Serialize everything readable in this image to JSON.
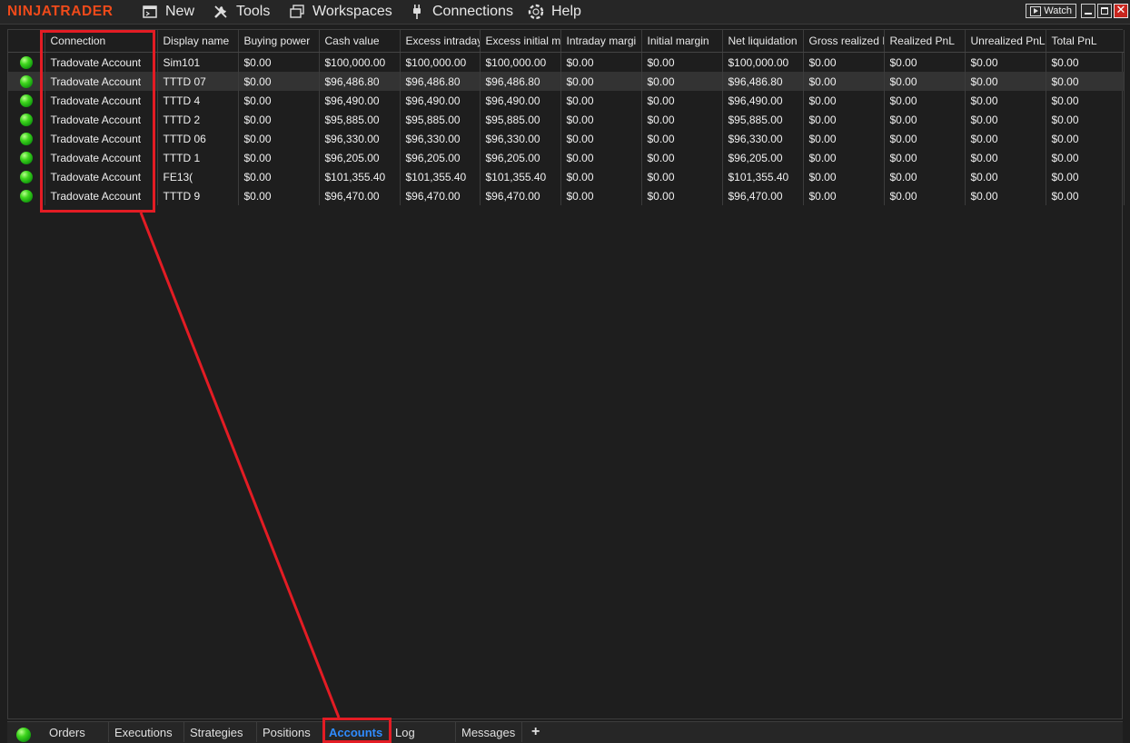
{
  "app": {
    "logo": "NINJATRADER",
    "menu": [
      "New",
      "Tools",
      "Workspaces",
      "Connections",
      "Help"
    ],
    "watch_label": "Watch",
    "close_glyph": "✕"
  },
  "accounts_grid": {
    "columns": [
      "",
      "Connection",
      "Display name",
      "Buying power",
      "Cash value",
      "Excess intraday",
      "Excess initial m",
      "Intraday margi",
      "Initial margin",
      "Net liquidation",
      "Gross realized I",
      "Realized PnL",
      "Unrealized PnL",
      "Total PnL"
    ],
    "rows": [
      {
        "status": "connected",
        "cells": [
          "Tradovate Account",
          "Sim101",
          "$0.00",
          "$100,000.00",
          "$100,000.00",
          "$100,000.00",
          "$0.00",
          "$0.00",
          "$100,000.00",
          "$0.00",
          "$0.00",
          "$0.00",
          "$0.00"
        ]
      },
      {
        "status": "connected",
        "cells": [
          "Tradovate Account",
          "TTTD      07",
          "$0.00",
          "$96,486.80",
          "$96,486.80",
          "$96,486.80",
          "$0.00",
          "$0.00",
          "$96,486.80",
          "$0.00",
          "$0.00",
          "$0.00",
          "$0.00"
        ]
      },
      {
        "status": "connected",
        "cells": [
          "Tradovate Account",
          "TTTD       4",
          "$0.00",
          "$96,490.00",
          "$96,490.00",
          "$96,490.00",
          "$0.00",
          "$0.00",
          "$96,490.00",
          "$0.00",
          "$0.00",
          "$0.00",
          "$0.00"
        ]
      },
      {
        "status": "connected",
        "cells": [
          "Tradovate Account",
          "TTTD       2",
          "$0.00",
          "$95,885.00",
          "$95,885.00",
          "$95,885.00",
          "$0.00",
          "$0.00",
          "$95,885.00",
          "$0.00",
          "$0.00",
          "$0.00",
          "$0.00"
        ]
      },
      {
        "status": "connected",
        "cells": [
          "Tradovate Account",
          "TTTD      06",
          "$0.00",
          "$96,330.00",
          "$96,330.00",
          "$96,330.00",
          "$0.00",
          "$0.00",
          "$96,330.00",
          "$0.00",
          "$0.00",
          "$0.00",
          "$0.00"
        ]
      },
      {
        "status": "connected",
        "cells": [
          "Tradovate Account",
          "TTTD      1",
          "$0.00",
          "$96,205.00",
          "$96,205.00",
          "$96,205.00",
          "$0.00",
          "$0.00",
          "$96,205.00",
          "$0.00",
          "$0.00",
          "$0.00",
          "$0.00"
        ]
      },
      {
        "status": "connected",
        "cells": [
          "Tradovate Account",
          "FE13(",
          "$0.00",
          "$101,355.40",
          "$101,355.40",
          "$101,355.40",
          "$0.00",
          "$0.00",
          "$101,355.40",
          "$0.00",
          "$0.00",
          "$0.00",
          "$0.00"
        ]
      },
      {
        "status": "connected",
        "cells": [
          "Tradovate Account",
          "TTTD       9",
          "$0.00",
          "$96,470.00",
          "$96,470.00",
          "$96,470.00",
          "$0.00",
          "$0.00",
          "$96,470.00",
          "$0.00",
          "$0.00",
          "$0.00",
          "$0.00"
        ]
      }
    ]
  },
  "bottom_tabs": {
    "items": [
      "Orders",
      "Executions",
      "Strategies",
      "Positions",
      "Accounts",
      "Log",
      "Messages"
    ],
    "active": "Accounts",
    "add_label": "+"
  },
  "colors": {
    "logo": "#f04a1a",
    "active_tab": "#2f8cff",
    "annotation": "#e31c24",
    "status_connected": "#3fd61e"
  }
}
